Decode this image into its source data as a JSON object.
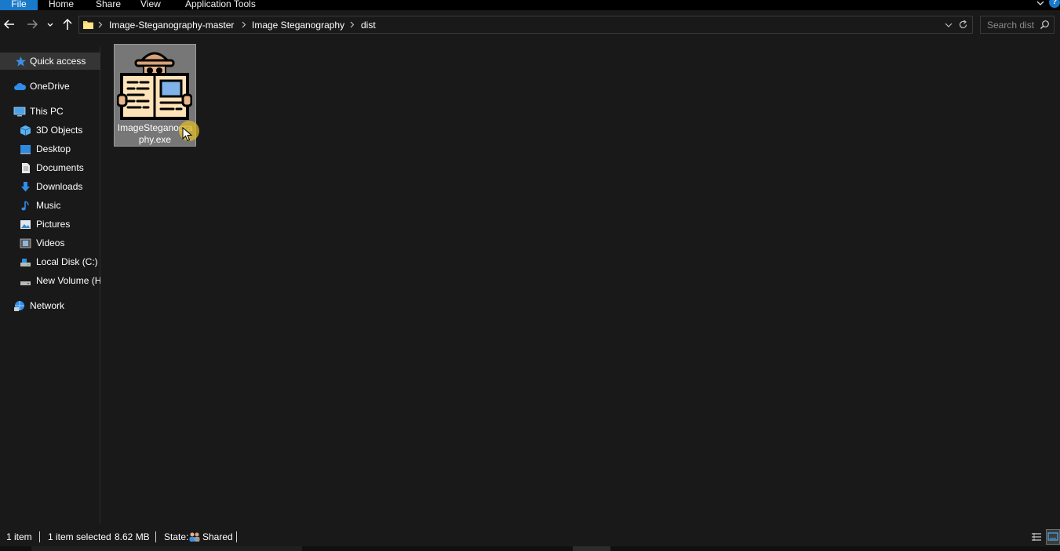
{
  "ribbon": {
    "tabs": [
      {
        "label": "File"
      },
      {
        "label": "Home"
      },
      {
        "label": "Share"
      },
      {
        "label": "View"
      },
      {
        "label": "Application Tools"
      }
    ],
    "help_label": "?"
  },
  "address": {
    "crumbs": [
      "Image-Steganography-master",
      "Image Steganography",
      "dist"
    ]
  },
  "search": {
    "placeholder": "Search dist"
  },
  "sidebar": {
    "items": [
      {
        "label": "Quick access",
        "icon": "star-icon"
      },
      {
        "label": "OneDrive",
        "icon": "cloud-icon"
      },
      {
        "label": "This PC",
        "icon": "computer-icon"
      },
      {
        "label": "3D Objects",
        "icon": "cube-icon"
      },
      {
        "label": "Desktop",
        "icon": "desktop-icon"
      },
      {
        "label": "Documents",
        "icon": "document-icon"
      },
      {
        "label": "Downloads",
        "icon": "download-arrow-icon"
      },
      {
        "label": "Music",
        "icon": "music-note-icon"
      },
      {
        "label": "Pictures",
        "icon": "picture-icon"
      },
      {
        "label": "Videos",
        "icon": "video-icon"
      },
      {
        "label": "Local Disk (C:)",
        "icon": "hard-drive-icon"
      },
      {
        "label": "New Volume (H",
        "icon": "drive-icon"
      },
      {
        "label": "Network",
        "icon": "network-icon"
      }
    ]
  },
  "files": [
    {
      "name": "ImageSteganography.exe",
      "icon": "spy-newspaper-icon",
      "selected": true
    }
  ],
  "status": {
    "item_count": "1 item",
    "selected": "1 item selected",
    "size": "8.62 MB",
    "state_label": "State:",
    "state_value": "Shared"
  },
  "colors": {
    "accent": "#1979ca",
    "background": "#191919",
    "selection": "#777777"
  }
}
